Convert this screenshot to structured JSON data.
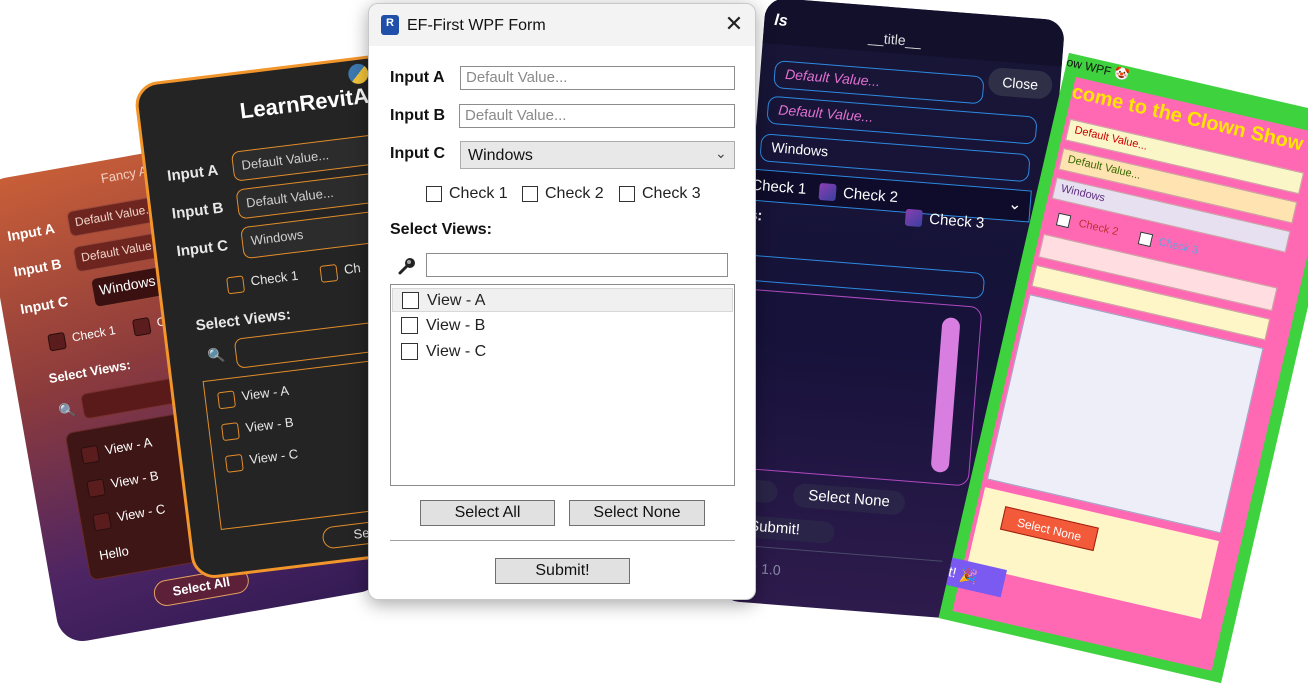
{
  "fancy": {
    "title": "Fancy AI Fo",
    "input_a_label": "Input A",
    "input_a_value": "Default Value...",
    "input_b_label": "Input B",
    "input_b_value": "Default Value...",
    "input_c_label": "Input C",
    "input_c_value": "Windows",
    "check1": "Check 1",
    "check2": "Che",
    "select_views": "Select Views:",
    "views": [
      "View - A",
      "View - B",
      "View - C"
    ],
    "extra_item": "Hello",
    "select_all": "Select All",
    "colors": {
      "top": "#c95f38",
      "bottom": "#331b54"
    }
  },
  "learn": {
    "title": "LearnRevitA",
    "input_a_label": "Input A",
    "input_a_value": "Default Value...",
    "input_b_label": "Input B",
    "input_b_value": "Default Value...",
    "input_c_label": "Input C",
    "input_c_value": "Windows",
    "check1": "Check 1",
    "check2": "Ch",
    "select_views": "Select Views:",
    "views": [
      "View - A",
      "View - B",
      "View - C"
    ],
    "select_all": "Select A",
    "colors": {
      "accent": "#f2952b",
      "background": "#242424"
    }
  },
  "dark": {
    "title_left": "ls",
    "title": "__title__",
    "close": "Close",
    "input_a_value": "Default Value...",
    "input_b_value": "Default Value...",
    "input_c_value": "Windows",
    "check1": "Check 1",
    "check2": "Check 2",
    "check3": "Check 3",
    "views_label_tail": "s:",
    "select_all_tail": "ll",
    "select_none": "Select None",
    "submit": "Submit!",
    "version": "ersion: 1.0",
    "colors": {
      "accent": "#2d8ae0",
      "text": "#e070d0",
      "scrollbar": "#d77ee0"
    }
  },
  "clown": {
    "title": "ow WPF 🤡",
    "heading": "come to the Clown Show",
    "input_a_value": "Default Value...",
    "input_b_value": "Default Value...",
    "input_c_value": "Windows",
    "check2": "Check 2",
    "check3": "Check 3",
    "select_none": "Select None",
    "submit": "t! 🎉",
    "colors": {
      "border": "#3fd23f",
      "background": "#ff69b4",
      "heading": "#ffe600"
    }
  },
  "main": {
    "title": "EF-First WPF Form",
    "close_icon": "close-icon",
    "input_a_label": "Input A",
    "input_a_placeholder": "Default Value...",
    "input_b_label": "Input B",
    "input_b_placeholder": "Default Value...",
    "input_c_label": "Input C",
    "input_c_value": "Windows",
    "checks": [
      "Check 1",
      "Check 2",
      "Check 3"
    ],
    "select_views": "Select Views:",
    "search_icon": "search-icon",
    "views": [
      "View - A",
      "View - B",
      "View - C"
    ],
    "select_all": "Select All",
    "select_none": "Select None",
    "submit": "Submit!"
  }
}
